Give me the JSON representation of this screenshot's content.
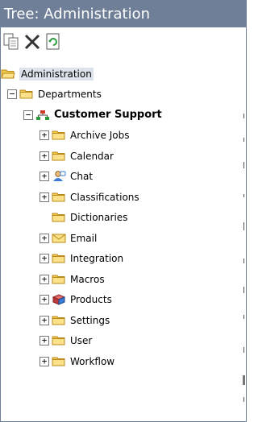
{
  "window": {
    "title": "Tree: Administration"
  },
  "toolbar": {
    "buttons": [
      {
        "name": "copy-icon"
      },
      {
        "name": "delete-icon"
      },
      {
        "name": "refresh-icon"
      }
    ]
  },
  "tree": {
    "root": "Administration",
    "departments": "Departments",
    "customer_support": "Customer Support",
    "items": [
      {
        "label": "Archive Jobs",
        "icon": "folder-icon",
        "expandable": true
      },
      {
        "label": "Calendar",
        "icon": "folder-icon",
        "expandable": true
      },
      {
        "label": "Chat",
        "icon": "chat-user-icon",
        "expandable": true
      },
      {
        "label": "Classifications",
        "icon": "folder-icon",
        "expandable": true
      },
      {
        "label": "Dictionaries",
        "icon": "folder-icon",
        "expandable": false
      },
      {
        "label": "Email",
        "icon": "envelope-icon",
        "expandable": true
      },
      {
        "label": "Integration",
        "icon": "folder-icon",
        "expandable": true
      },
      {
        "label": "Macros",
        "icon": "folder-icon",
        "expandable": true
      },
      {
        "label": "Products",
        "icon": "products-icon",
        "expandable": true
      },
      {
        "label": "Settings",
        "icon": "folder-icon",
        "expandable": true
      },
      {
        "label": "User",
        "icon": "folder-icon",
        "expandable": true
      },
      {
        "label": "Workflow",
        "icon": "folder-icon",
        "expandable": true
      }
    ]
  },
  "colors": {
    "titlebar": "#6f7f98",
    "folder": "#f2c94c",
    "selection": "#dde3ea"
  }
}
